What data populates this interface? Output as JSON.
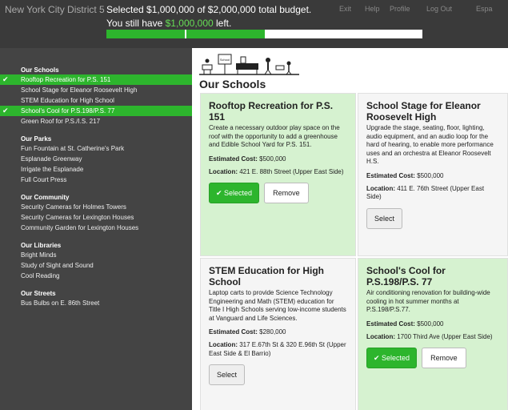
{
  "header": {
    "district": "New York City District 5",
    "budget_prefix": "Selected ",
    "selected_amount": "$1,000,000",
    "budget_mid": " of ",
    "total_amount": "$2,000,000",
    "budget_suffix": " total budget.",
    "left_prefix": "You still have ",
    "left_amount": "$1,000,000",
    "left_suffix": " left.",
    "progress_fraction": 0.5,
    "nav": [
      "Exit",
      "Help",
      "Profile",
      "Log Out",
      "Espa"
    ]
  },
  "sidebar": {
    "sections": [
      {
        "title": "Our Schools",
        "items": [
          {
            "label": "Rooftop Recreation for P.S. 151",
            "selected": true
          },
          {
            "label": "School Stage for Eleanor Roosevelt High",
            "selected": false
          },
          {
            "label": "STEM Education for High School",
            "selected": false
          },
          {
            "label": "School's Cool for P.S.198/P.S. 77",
            "selected": true
          },
          {
            "label": "Green Roof for P.S./I.S. 217",
            "selected": false
          }
        ]
      },
      {
        "title": "Our Parks",
        "items": [
          {
            "label": "Fun Fountain at St. Catherine's Park",
            "selected": false
          },
          {
            "label": "Esplanade Greenway",
            "selected": false
          },
          {
            "label": "Irrigate the Esplanade",
            "selected": false
          },
          {
            "label": "Full Court Press",
            "selected": false
          }
        ]
      },
      {
        "title": "Our Community",
        "items": [
          {
            "label": "Security Cameras for Holmes Towers",
            "selected": false
          },
          {
            "label": "Security Cameras for Lexington Houses",
            "selected": false
          },
          {
            "label": "Community Garden for Lexington Houses",
            "selected": false
          }
        ]
      },
      {
        "title": "Our Libraries",
        "items": [
          {
            "label": "Bright Minds",
            "selected": false
          },
          {
            "label": "Study of Sight and Sound",
            "selected": false
          },
          {
            "label": "Cool Reading",
            "selected": false
          }
        ]
      },
      {
        "title": "Our Streets",
        "items": [
          {
            "label": "Bus Bulbs on E. 86th Street",
            "selected": false
          }
        ]
      }
    ]
  },
  "main": {
    "banner_sign": "School",
    "title": "Our Schools",
    "cost_label": "Estimated Cost:",
    "location_label": "Location:",
    "selected_label": "✔ Selected",
    "remove_label": "Remove",
    "select_label": "Select",
    "cards": [
      {
        "title": "Rooftop Recreation for P.S. 151",
        "description": "Create a necessary outdoor play space on the roof with the opportunity to add a greenhouse and Edible School Yard for P.S. 151.",
        "cost": "$500,000",
        "location": "421 E. 88th Street (Upper East Side)",
        "selected": true
      },
      {
        "title": "School Stage for Eleanor Roosevelt High",
        "description": "Upgrade the stage, seating, floor, lighting, audio equipment, and an audio loop for the hard of hearing, to enable more performance uses and an orchestra at Eleanor Roosevelt H.S.",
        "cost": "$500,000",
        "location": "411 E. 76th Street (Upper East Side)",
        "selected": false
      },
      {
        "title": "STEM Education for High School",
        "description": "Laptop carts to provide Science Technology Engineering and Math (STEM) education for Title I High Schools serving low-income students at Vanguard and Life Sciences.",
        "cost": "$280,000",
        "location": "317 E.67th St & 320 E.96th St (Upper East Side & El Barrio)",
        "selected": false
      },
      {
        "title": "School's Cool for P.S.198/P.S. 77",
        "description": "Air conditioning renovation for building-wide cooling in hot summer months at P.S.198/P.S.77.",
        "cost": "$500,000",
        "location": "1700 Third Ave (Upper East Side)",
        "selected": true
      }
    ]
  }
}
